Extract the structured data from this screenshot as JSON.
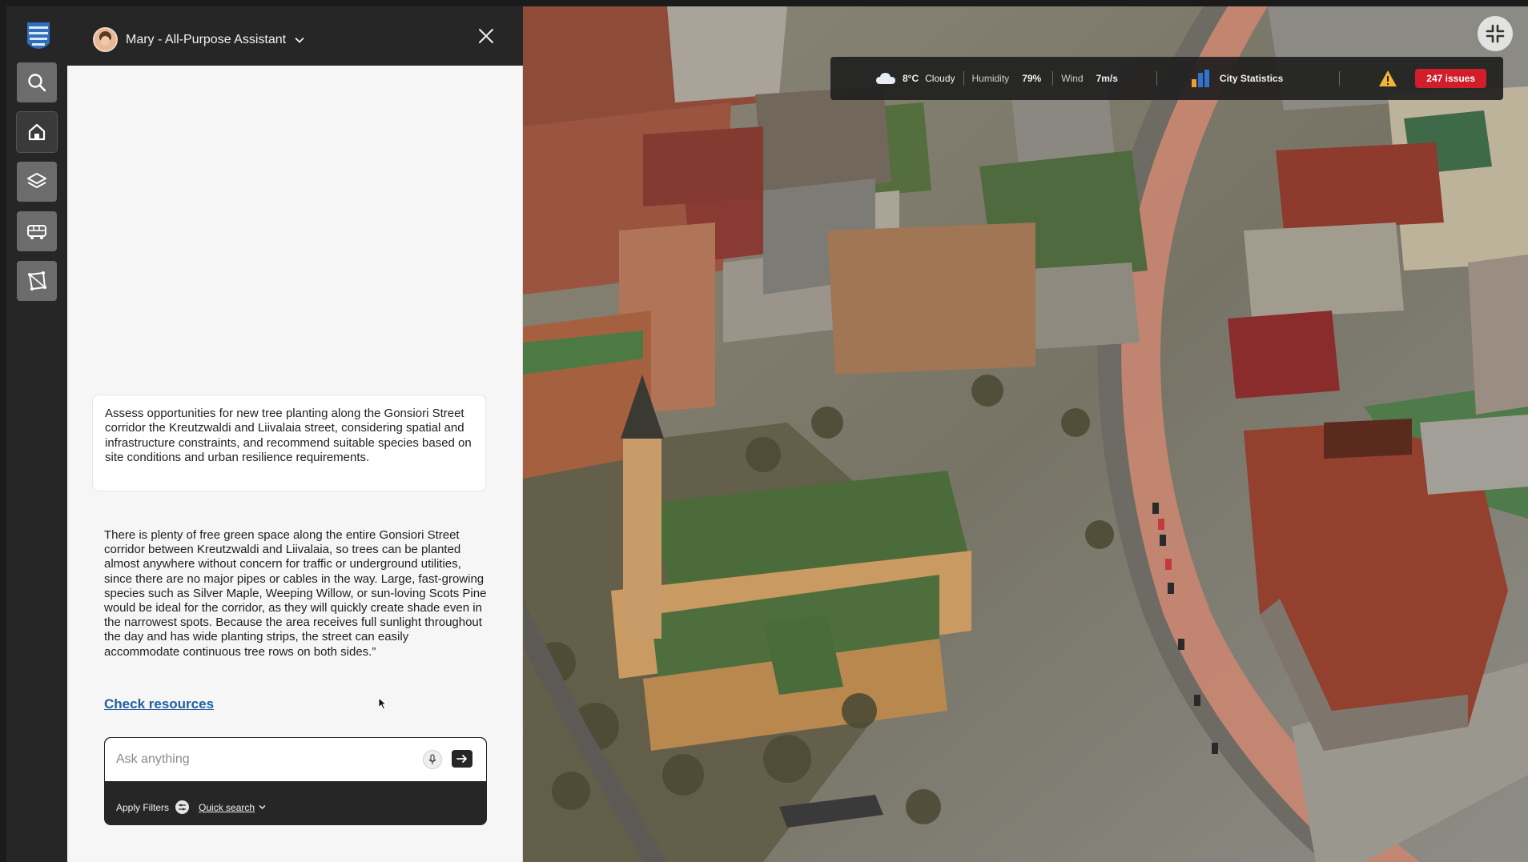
{
  "assistant": {
    "name": "Mary - All-Purpose Assistant"
  },
  "conversation": {
    "user_message": "Assess opportunities for new tree planting along the Gonsiori Street corridor the Kreutzwaldi and Liivalaia street, considering spatial and infrastructure constraints, and recommend suitable species based on site conditions and urban resilience requirements.",
    "assistant_message": "There is plenty of free green space along the entire Gonsiori Street corridor between Kreutzwaldi and Liivalaia, so trees can be planted almost anywhere without concern for traffic or underground utilities, since there are no major pipes or cables in the way. Large, fast-growing species such as Silver Maple, Weeping Willow, or sun-loving Scots Pine would be ideal for the corridor, as they will quickly create shade even in the narrowest spots. Because the area receives full sunlight throughout the day and has wide planting strips, the street can easily accommodate continuous tree rows on both sides.”",
    "link_label": "Check resources"
  },
  "composer": {
    "placeholder": "Ask anything",
    "apply_filters_label": "Apply Filters",
    "quick_search_label": "Quick search"
  },
  "sidebar": {
    "items": [
      {
        "name": "search",
        "icon": "search-icon"
      },
      {
        "name": "home",
        "icon": "home-icon",
        "active": true
      },
      {
        "name": "layers",
        "icon": "layers-icon"
      },
      {
        "name": "transport",
        "icon": "bus-icon"
      },
      {
        "name": "measure",
        "icon": "measure-area-icon"
      }
    ]
  },
  "status_bar": {
    "temperature": "8°C",
    "condition": "Cloudy",
    "humidity_label": "Humidity",
    "humidity_value": "79%",
    "wind_label": "Wind",
    "wind_value": "7m/s",
    "stats_label": "City Statistics",
    "issues_label": "247 issues"
  },
  "colors": {
    "accent_link": "#1f5f9e",
    "issues_red": "#d21d2a",
    "dark_ui": "#262626"
  }
}
